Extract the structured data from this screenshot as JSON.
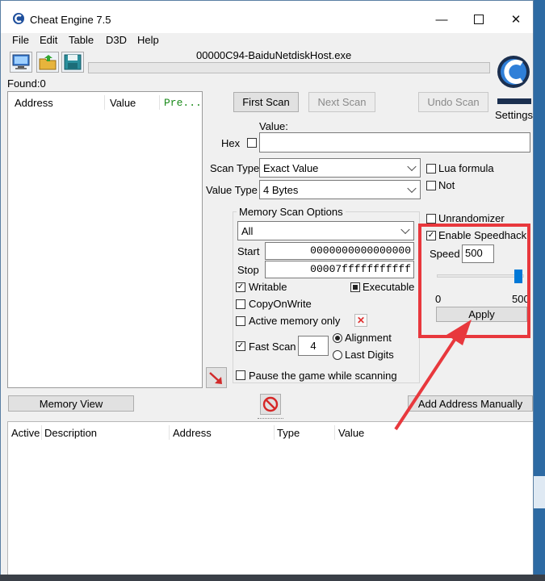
{
  "window": {
    "title": "Cheat Engine 7.5",
    "process_name": "00000C94-BaiduNetdiskHost.exe",
    "found_label": "Found:0"
  },
  "menu": [
    "File",
    "Edit",
    "Table",
    "D3D",
    "Help"
  ],
  "toolbar": {
    "open_process_icon": "computer-monitor-icon",
    "open_file_icon": "folder-open-icon",
    "save_icon": "floppy-save-icon"
  },
  "found_list": {
    "columns": [
      "Address",
      "Value",
      "Pre..."
    ]
  },
  "scan": {
    "first_scan": "First Scan",
    "next_scan": "Next Scan",
    "undo_scan": "Undo Scan",
    "settings": "Settings",
    "value_label": "Value:",
    "hex_label": "Hex",
    "value_input": "",
    "scan_type_label": "Scan Type",
    "scan_type_value": "Exact Value",
    "value_type_label": "Value Type",
    "value_type_value": "4 Bytes",
    "lua_formula": "Lua formula",
    "not_label": "Not"
  },
  "memory_options": {
    "title": "Memory Scan Options",
    "region": "All",
    "start_label": "Start",
    "start_value": "0000000000000000",
    "stop_label": "Stop",
    "stop_value": "00007fffffffffff",
    "writable": "Writable",
    "executable": "Executable",
    "copy_on_write": "CopyOnWrite",
    "active_memory_only": "Active memory only",
    "fast_scan": "Fast Scan",
    "fast_scan_value": "4",
    "alignment": "Alignment",
    "last_digits": "Last Digits",
    "pause_game": "Pause the game while scanning"
  },
  "speedhack": {
    "unrandomizer": "Unrandomizer",
    "enable_speedhack": "Enable Speedhack",
    "speed_label": "Speed",
    "speed_value": "500",
    "slider_min": "0",
    "slider_max": "500",
    "slider_fraction": 1.0,
    "apply": "Apply"
  },
  "bottom": {
    "memory_view": "Memory View",
    "add_address_manually": "Add Address Manually",
    "columns": [
      "Active",
      "Description",
      "Address",
      "Type",
      "Value"
    ]
  },
  "colors": {
    "highlight_box": "#e8383d",
    "arrow": "#e8383d",
    "pre_column": "#1a8a1a"
  }
}
